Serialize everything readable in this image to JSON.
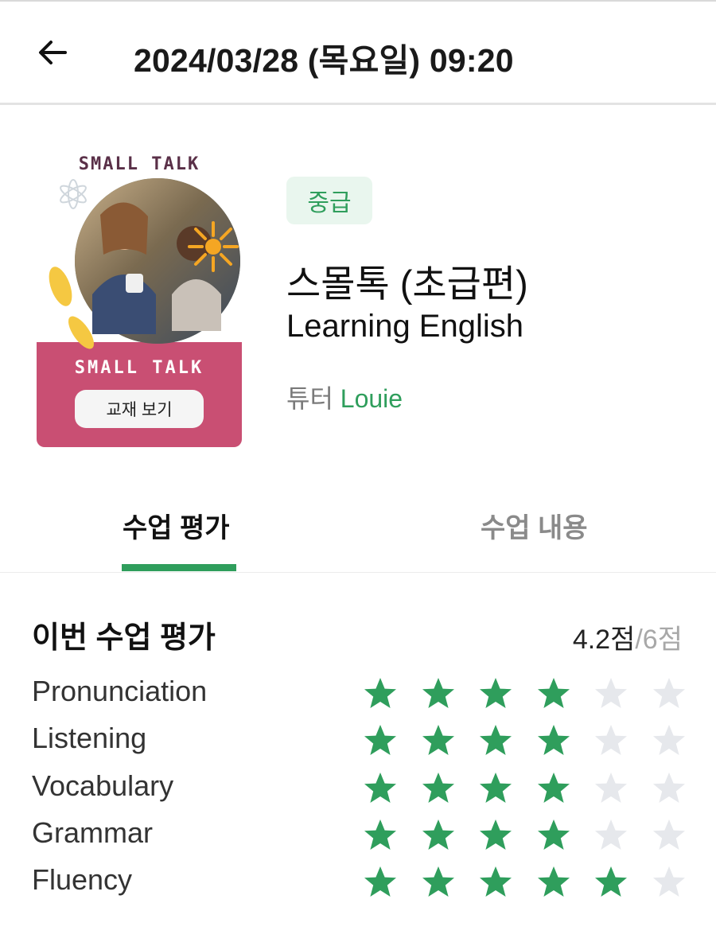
{
  "header": {
    "title": "2024/03/28 (목요일) 09:20",
    "back_icon": "arrow-left-icon"
  },
  "cover": {
    "top_text": "SMALL TALK",
    "bottom_text": "SMALL TALK",
    "textbook_button": "교재 보기",
    "accent_color": "#c94f73"
  },
  "course": {
    "level": "중급",
    "title": "스몰톡 (초급편)",
    "subtitle": "Learning English",
    "tutor_label": "튜터",
    "tutor_name": "Louie"
  },
  "tabs": [
    {
      "label": "수업 평가",
      "active": true
    },
    {
      "label": "수업 내용",
      "active": false
    }
  ],
  "rating": {
    "title": "이번 수업 평가",
    "score": "4.2점",
    "total": "/6점",
    "max_stars": 6,
    "items": [
      {
        "label": "Pronunciation",
        "stars": 4
      },
      {
        "label": "Listening",
        "stars": 4
      },
      {
        "label": "Vocabulary",
        "stars": 4
      },
      {
        "label": "Grammar",
        "stars": 4
      },
      {
        "label": "Fluency",
        "stars": 5
      }
    ]
  },
  "colors": {
    "accent": "#2f9e5c",
    "star_filled": "#2f9e5c",
    "star_empty": "#e6e8ec"
  }
}
